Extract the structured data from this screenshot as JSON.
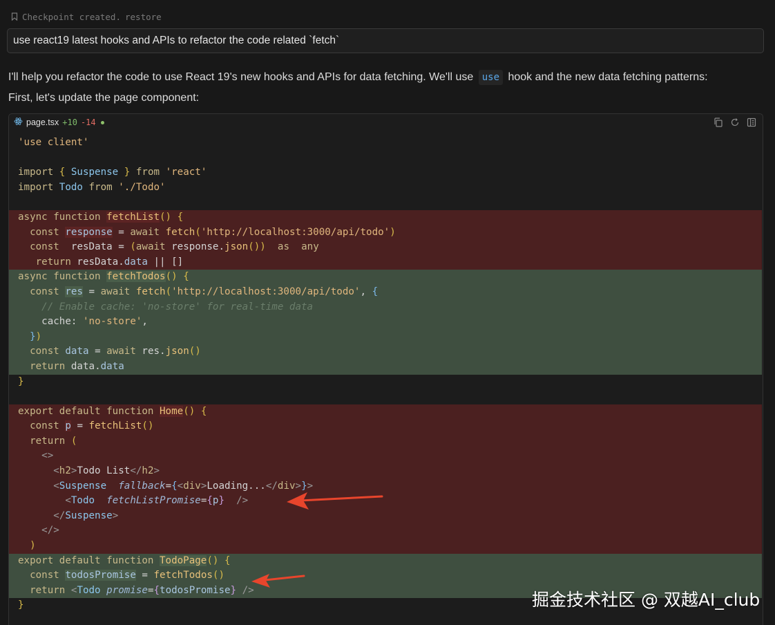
{
  "checkpoint": {
    "icon": "bookmark-icon",
    "text": "Checkpoint created.",
    "restore_label": "restore"
  },
  "prompt": {
    "text": "use react19 latest hooks and APIs to refactor the code related `fetch`"
  },
  "response": {
    "p1_before": "I'll help you refactor the code to use React 19's new hooks and APIs for data fetching. We'll use",
    "p1_code": "use",
    "p1_after": "hook and the new data fetching patterns:",
    "p2": "First, let's update the page component:"
  },
  "code_block": {
    "filename": "page.tsx",
    "added": "+10",
    "removed": "-14",
    "icons": [
      "react-file-icon",
      "copy-icon",
      "refresh-icon",
      "apply-icon"
    ],
    "lines": [
      "'use client'",
      "",
      "import { Suspense } from 'react'",
      "import Todo from './Todo'",
      "",
      "async function fetchList() {",
      "  const response = await fetch('http://localhost:3000/api/todo')",
      "  const resData = (await response.json()) as any",
      "  return resData.data || []",
      "async function fetchTodos() {",
      "  const res = await fetch('http://localhost:3000/api/todo', {",
      "    // Enable cache: 'no-store' for real-time data",
      "    cache: 'no-store',",
      "  })",
      "  const data = await res.json()",
      "  return data.data",
      "}",
      "",
      "export default function Home() {",
      "  const p = fetchList()",
      "  return (",
      "    <>",
      "      <h2>Todo List</h2>",
      "      <Suspense fallback={<div>Loading...</div>}>",
      "        <Todo fetchListPromise={p} />",
      "      </Suspense>",
      "    </>",
      "  )",
      "export default function TodoPage() {",
      "  const todosPromise = fetchTodos()",
      "  return <Todo promise={todosPromise} />",
      "}"
    ]
  },
  "watermark": "掘金技术社区 @ 双越AI_club",
  "colors": {
    "background": "#181818",
    "removed_bg": "#4b2020",
    "added_bg": "#3f4f40",
    "arrow": "#e8452c"
  }
}
